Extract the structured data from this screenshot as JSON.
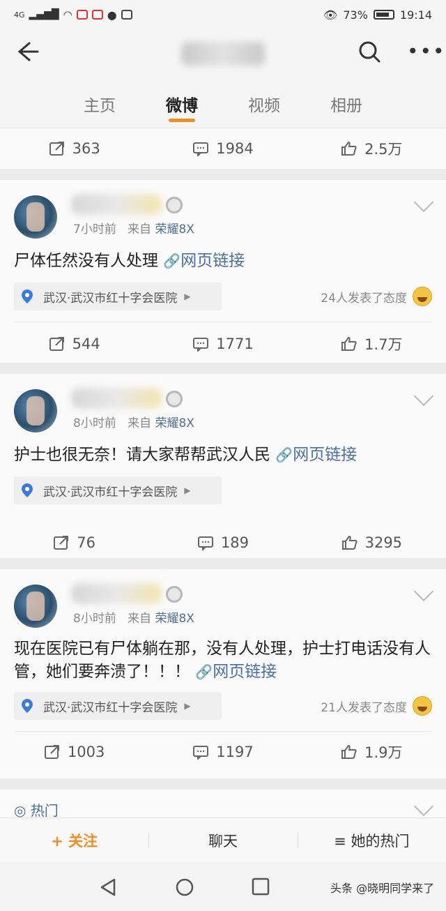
{
  "status": {
    "battery": "73%",
    "time": "19:14",
    "network": "4G"
  },
  "header": {
    "title": ""
  },
  "tabs": [
    {
      "label": "主页"
    },
    {
      "label": "微博"
    },
    {
      "label": "视频"
    },
    {
      "label": "相册"
    }
  ],
  "first_actions": {
    "repost": "363",
    "comment": "1984",
    "like": "2.5万"
  },
  "posts": [
    {
      "time": "7小时前",
      "from": "来自",
      "device": "荣耀8X",
      "text": "尸体任然没有人处理",
      "link": "网页链接",
      "location": "武汉·武汉市红十字会医院",
      "attitude": "24人发表了态度",
      "repost": "544",
      "comment": "1771",
      "like": "1.7万"
    },
    {
      "time": "8小时前",
      "from": "来自",
      "device": "荣耀8X",
      "text": "护士也很无奈！请大家帮帮武汉人民",
      "link": "网页链接",
      "location": "武汉·武汉市红十字会医院",
      "attitude": "",
      "repost": "76",
      "comment": "189",
      "like": "3295"
    },
    {
      "time": "8小时前",
      "from": "来自",
      "device": "荣耀8X",
      "text": "现在医院已有尸体躺在那，没有人处理，护士打电话没有人管，她们要奔溃了！！！",
      "link": "网页链接",
      "location": "武汉·武汉市红十字会医院",
      "attitude": "21人发表了态度",
      "repost": "1003",
      "comment": "1197",
      "like": "1.9万"
    }
  ],
  "hot_label": "热门",
  "bottom": {
    "follow": "+ 关注",
    "chat": "聊天",
    "hot": "≡ 她的热门"
  },
  "watermark": "头条 @晓明同学来了",
  "colors": {
    "accent": "#f28c28",
    "link": "#4a6f9c"
  }
}
